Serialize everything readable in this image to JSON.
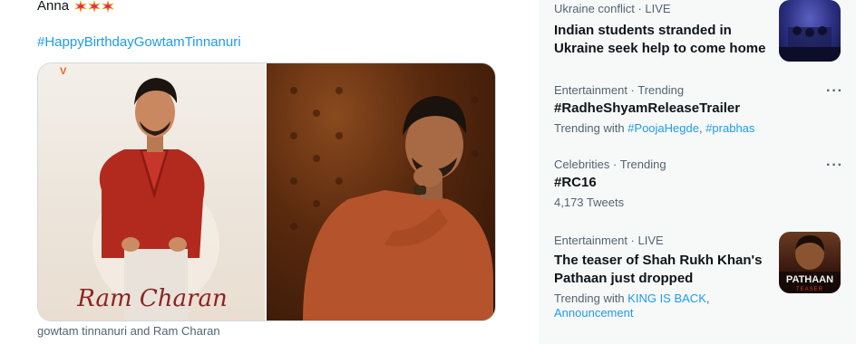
{
  "tweet": {
    "text": "Anna",
    "emoji_name": "collision-emoji",
    "hashtag": "#HappyBirthdayGowtamTinnanuri",
    "photo_left_caption": "Ram Charan",
    "caption": "gowtam tinnanuri and Ram Charan"
  },
  "trends": [
    {
      "meta": "Ukraine conflict · LIVE",
      "title": "Indian students stranded in Ukraine seek help to come home",
      "has_thumbnail": true
    },
    {
      "meta": "Entertainment · Trending",
      "title": "#RadheShyamReleaseTrailer",
      "sub_prefix": "Trending with ",
      "links": [
        "#PoojaHegde",
        "#prabhas"
      ],
      "more": "···"
    },
    {
      "meta": "Celebrities · Trending",
      "title": "#RC16",
      "sub": "4,173 Tweets",
      "more": "···"
    },
    {
      "meta": "Entertainment · LIVE",
      "title": "The teaser of Shah Rukh Khan's Pathaan just dropped",
      "sub_prefix": "Trending with ",
      "links": [
        "KING IS BACK",
        "Announcement"
      ],
      "thumb_title": "PATHAAN",
      "thumb_sub": "TEASER"
    }
  ],
  "colors": {
    "accent": "#1d9bf0",
    "muted": "#536471",
    "sidebar_bg": "#f7f9f9"
  }
}
